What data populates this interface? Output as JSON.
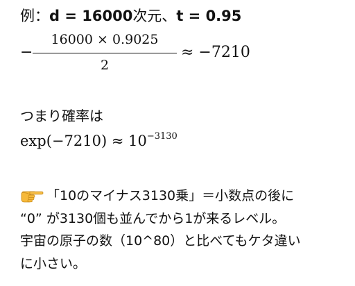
{
  "heading": {
    "prefix": "例：",
    "bold_text": "d = 16000",
    "mid_text": "次元、",
    "bold_text2": "t = 0.95"
  },
  "fraction_expression": {
    "leading_sign": "−",
    "numerator": "16000 × 0.9025",
    "denominator": "2",
    "result": "≈ −7210"
  },
  "probability_section": {
    "label": "つまり確率は",
    "expression_base": "exp(−7210) ≈ 10",
    "expression_exponent": "−3130"
  },
  "explanation": {
    "icon": "pointing-right-hand-icon",
    "line1": "「10のマイナス3130乗」＝小数点の後に",
    "line2": "“0” が3130個も並んでから1が来るレベル。",
    "line3": "宇宙の原子の数（10^80）と比べてもケタ違い",
    "line4": "に小さい。"
  }
}
